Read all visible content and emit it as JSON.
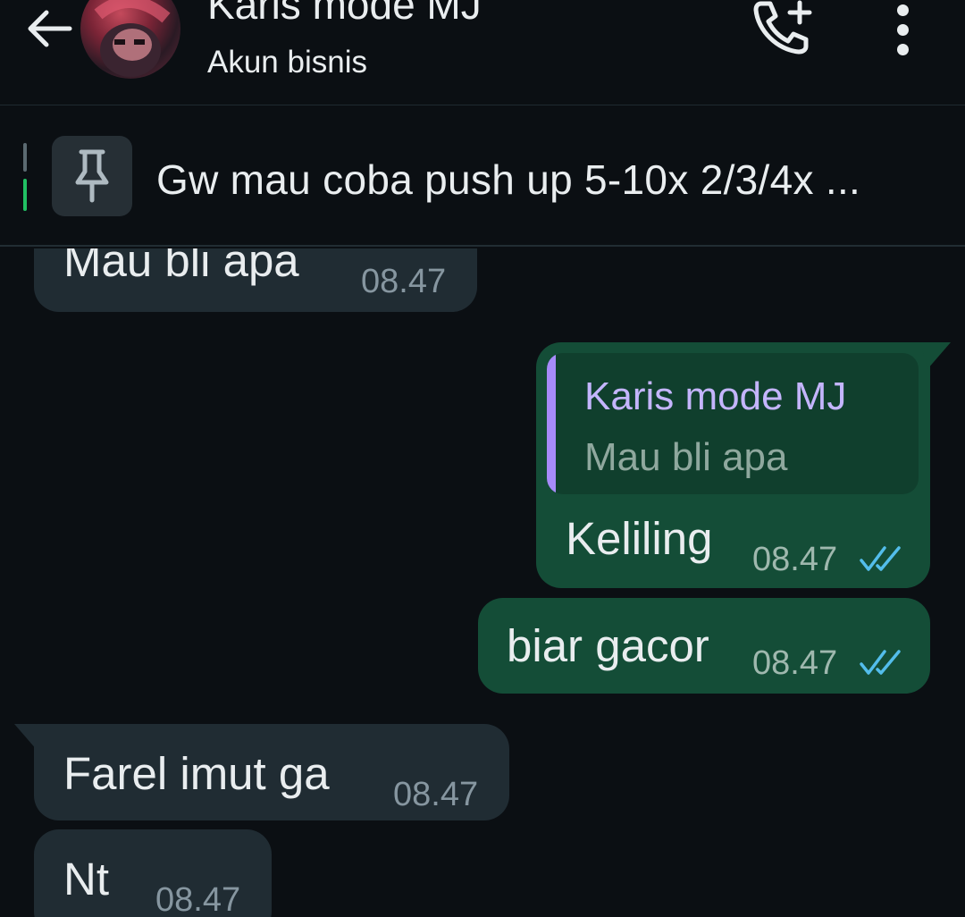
{
  "header": {
    "contact_name": "Karis mode MJ",
    "subtitle": "Akun bisnis",
    "icons": [
      "back-arrow-icon",
      "add-call-icon",
      "more-vert-icon"
    ]
  },
  "pinned": {
    "text": "Gw mau coba push up 5-10x 2/3/4x ...",
    "icon": "pin-icon"
  },
  "messages": [
    {
      "direction": "incoming",
      "text": "Mau bli apa",
      "time": "08.47"
    },
    {
      "direction": "outgoing",
      "quote": {
        "name": "Karis mode MJ",
        "text": "Mau bli apa"
      },
      "text": "Keliling",
      "time": "08.47",
      "status": "read"
    },
    {
      "direction": "outgoing",
      "text": "biar gacor",
      "time": "08.47",
      "status": "read"
    },
    {
      "direction": "incoming",
      "text": "Farel imut ga",
      "time": "08.47"
    },
    {
      "direction": "incoming",
      "text": "Nt",
      "time": "08.47"
    }
  ],
  "colors": {
    "background": "#0b0f13",
    "incoming_bubble": "#202c33",
    "outgoing_bubble": "#144d37",
    "read_ticks": "#53bdeb",
    "quote_accent": "#a78bfa"
  }
}
